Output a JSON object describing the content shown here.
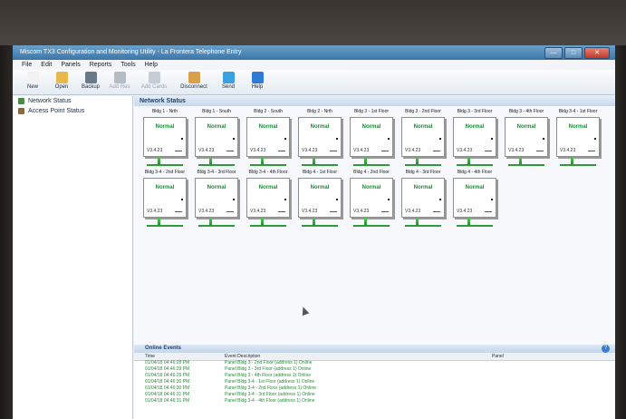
{
  "window": {
    "title": "Miscom TX3 Configuration and Monitoring Utility - La Frontera Telephone Entry",
    "buttons": [
      "—",
      "□",
      "✕"
    ]
  },
  "menu": [
    "File",
    "Edit",
    "Panels",
    "Reports",
    "Tools",
    "Help"
  ],
  "toolbar": [
    {
      "label": "New",
      "icon": "new-document-icon",
      "color": "#f2f2f2",
      "enabled": true
    },
    {
      "label": "Open",
      "icon": "folder-open-icon",
      "color": "#e8b84a",
      "enabled": true
    },
    {
      "label": "Backup",
      "icon": "backup-icon",
      "color": "#6a7a8a",
      "enabled": true
    },
    {
      "label": "Add Res",
      "icon": "add-resident-icon",
      "color": "#b4bcc6",
      "enabled": false
    },
    {
      "label": "Add Cards",
      "icon": "add-cards-icon",
      "color": "#c4ccd6",
      "enabled": false
    },
    {
      "label": "Disconnect",
      "icon": "disconnect-icon",
      "color": "#d8a04a",
      "enabled": true
    },
    {
      "label": "Send",
      "icon": "send-arrow-icon",
      "color": "#3aa0e0",
      "enabled": true
    },
    {
      "label": "Help",
      "icon": "help-icon",
      "color": "#2e7ad6",
      "enabled": true
    }
  ],
  "tree": [
    {
      "label": "Network Status",
      "icon": "network-icon",
      "color": "#4a8a4a"
    },
    {
      "label": "Access Point Status",
      "icon": "access-point-icon",
      "color": "#8a6a3a"
    }
  ],
  "network_status": {
    "title": "Network Status",
    "panels": [
      {
        "name": "Bldg 1 - Nrth",
        "status": "Normal",
        "version": "V3.4.23"
      },
      {
        "name": "Bldg 1 - South",
        "status": "Normal",
        "version": "V3.4.23"
      },
      {
        "name": "Bldg 2 - South",
        "status": "Normal",
        "version": "V3.4.23"
      },
      {
        "name": "Bldg 2 - Nrth",
        "status": "Normal",
        "version": "V3.4.23"
      },
      {
        "name": "Bldg 3 - 1st Floor",
        "status": "Normal",
        "version": "V3.4.23"
      },
      {
        "name": "Bldg 3 - 2nd Floor",
        "status": "Normal",
        "version": "V3.4.23"
      },
      {
        "name": "Bldg 3 - 3rd Floor",
        "status": "Normal",
        "version": "V3.4.23"
      },
      {
        "name": "Bldg 3 - 4th Floor",
        "status": "Normal",
        "version": "V3.4.23"
      },
      {
        "name": "Bldg 3-4 - 1st Floor",
        "status": "Normal",
        "version": "V3.4.23"
      },
      {
        "name": "Bldg 3-4 - 2nd Floor",
        "status": "Normal",
        "version": "V3.4.23"
      },
      {
        "name": "Bldg 3-4 - 3rd Floor",
        "status": "Normal",
        "version": "V3.4.23"
      },
      {
        "name": "Bldg 3-4 - 4th Floor",
        "status": "Normal",
        "version": "V3.4.23"
      },
      {
        "name": "Bldg 4 - 1st Floor",
        "status": "Normal",
        "version": "V3.4.23"
      },
      {
        "name": "Bldg 4 - 2nd Floor",
        "status": "Normal",
        "version": "V3.4.23"
      },
      {
        "name": "Bldg 4 - 3rd Floor",
        "status": "Normal",
        "version": "V3.4.23"
      },
      {
        "name": "Bldg 4 - 4th Floor",
        "status": "Normal",
        "version": "V3.4.23"
      }
    ]
  },
  "online_events": {
    "title": "Online Events",
    "columns": [
      "Time",
      "Event Description",
      "Panel"
    ],
    "rows": [
      {
        "time": "01/04/18 04:46:28 PM",
        "desc": "Panel Bldg 3 - 2nd Floor (address 1) Online"
      },
      {
        "time": "01/04/18 04:46:29 PM",
        "desc": "Panel Bldg 3 - 3rd Floor (address 1) Online"
      },
      {
        "time": "01/04/18 04:46:29 PM",
        "desc": "Panel Bldg 3 - 4th Floor (address 1) Online"
      },
      {
        "time": "01/04/18 04:46:30 PM",
        "desc": "Panel Bldg 3-4 - 1st Floor (address 1) Online"
      },
      {
        "time": "01/04/18 04:46:30 PM",
        "desc": "Panel Bldg 3-4 - 2nd Floor (address 1) Online"
      },
      {
        "time": "01/04/18 04:46:31 PM",
        "desc": "Panel Bldg 3-4 - 3rd Floor (address 1) Online"
      },
      {
        "time": "01/04/18 04:46:31 PM",
        "desc": "Panel Bldg 3-4 - 4th Floor (address 1) Online"
      }
    ]
  },
  "colors": {
    "status_green": "#1d8a36",
    "header_blue": "#1f3f6f"
  }
}
